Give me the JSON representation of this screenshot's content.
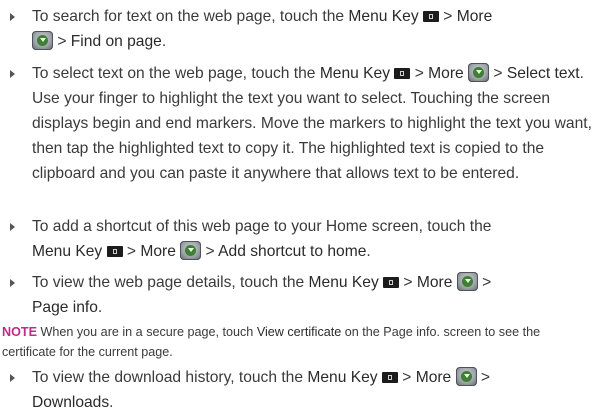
{
  "bullets": [
    {
      "t1": "To search for text on the web page, touch the ",
      "menu_key": "Menu Key",
      "sep1": " > ",
      "more": "More",
      "sep2": " > ",
      "target": "Find on page",
      "end": "."
    },
    {
      "t1": "To select text on the web page, touch the ",
      "menu_key": "Menu Key",
      "sep1": " > ",
      "more": "More",
      "sep2": " > ",
      "target": "Select text",
      "end": ". Use your finger to highlight the text you want to select. Touching the screen displays begin and end markers. Move the markers to highlight the text you want, then tap the highlighted text to copy it. The highlighted text is copied to the clipboard and you can paste it anywhere that allows text to be entered."
    },
    {
      "t1": "To add a shortcut of this web page to your Home screen, touch the ",
      "menu_key": "Menu Key",
      "sep1": " > ",
      "more": "More",
      "sep2": " > ",
      "target": "Add shortcut to home",
      "end": "."
    },
    {
      "t1": "To view the web page details, touch the ",
      "menu_key": "Menu Key",
      "sep1": " > ",
      "more": "More",
      "sep2": " > ",
      "target": "Page info",
      "end": "."
    },
    {
      "t1": "To view the download history, touch the ",
      "menu_key": "Menu Key",
      "sep1": " > ",
      "more": "More",
      "sep2": " > ",
      "target": "Downloads",
      "end": "."
    }
  ],
  "note": {
    "label": "NOTE",
    "t1": " When you are in a secure page, touch ",
    "strong": "View certificate",
    "t2": " on the Page info. screen to see the certificate for the current page."
  },
  "colors": {
    "note_label": "#c02a86",
    "text": "#3a3a3a"
  },
  "icons": {
    "menu": "menu-key-icon",
    "more": "more-icon"
  }
}
